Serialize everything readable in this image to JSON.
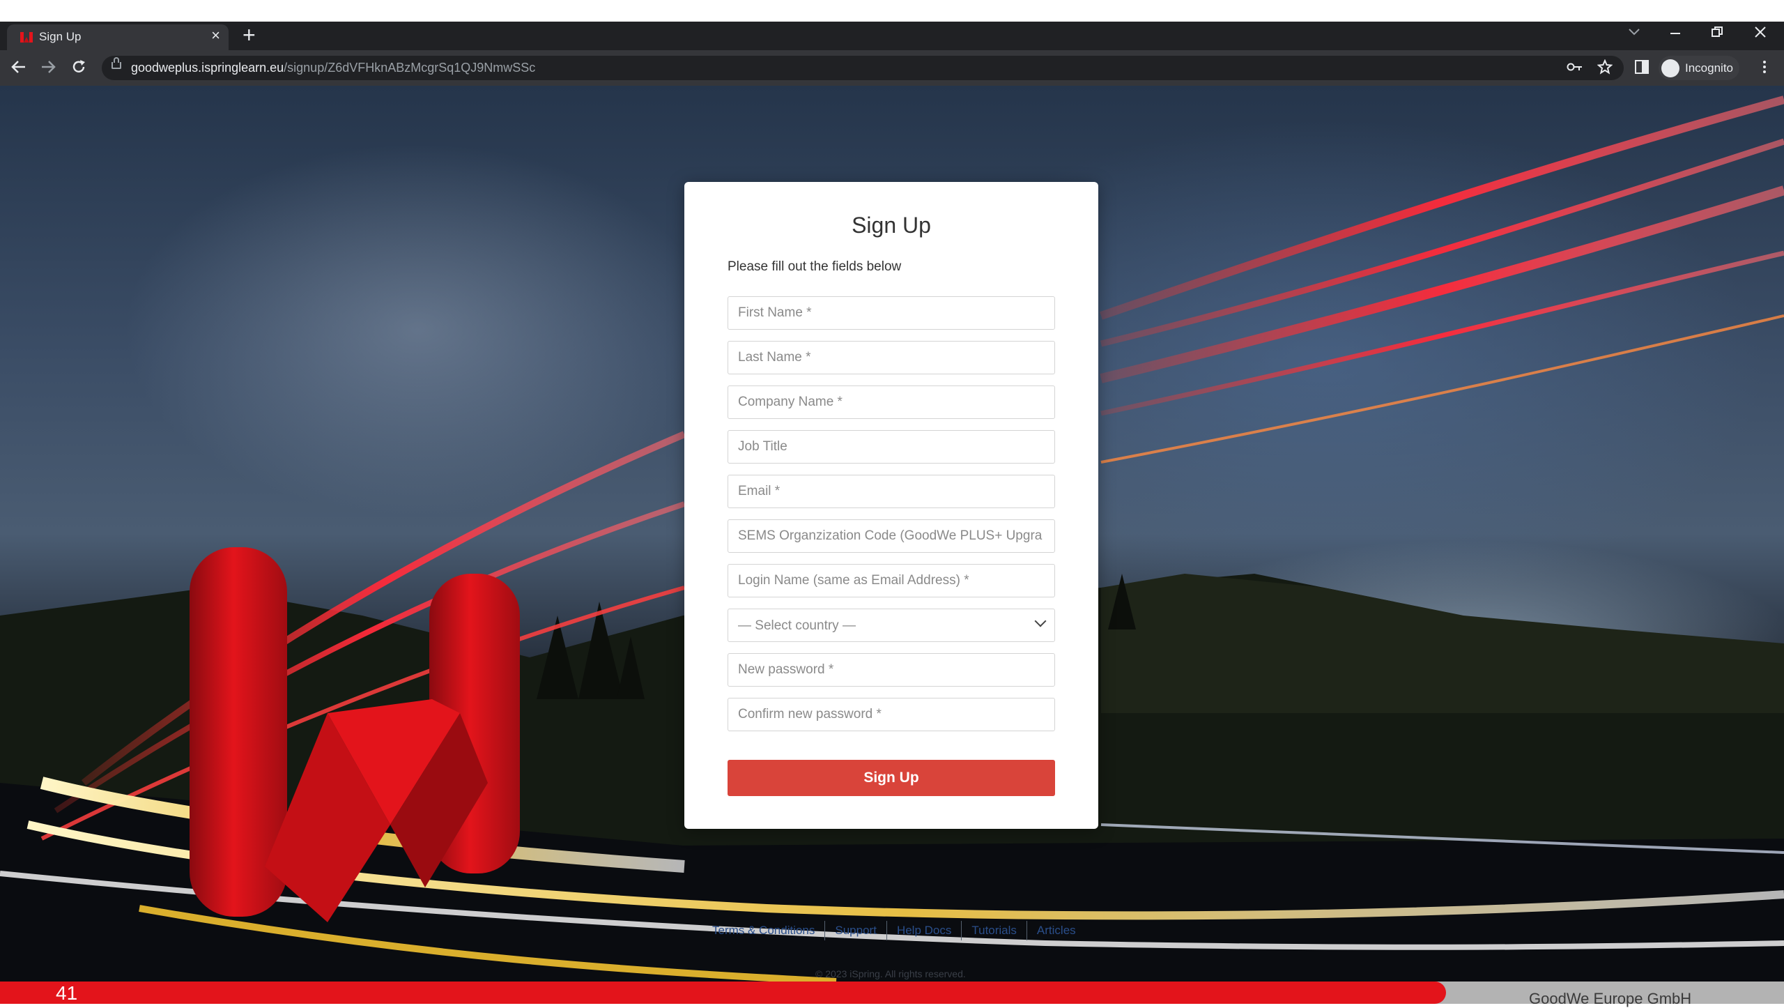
{
  "browser": {
    "tab_title": "Sign Up",
    "tab_close": "×",
    "new_tab": "+",
    "url_host": "goodweplus.ispringlearn.eu",
    "url_path": "/signup/Z6dVFHknABzMcgrSq1QJ9NmwSSc",
    "incognito_label": "Incognito",
    "icons": [
      "back-icon",
      "forward-icon",
      "reload-icon",
      "lock-icon",
      "key-icon",
      "star-icon",
      "side-panel-icon",
      "incognito-icon",
      "menu-icon",
      "tab-search-icon",
      "minimize-icon",
      "restore-icon",
      "close-icon"
    ]
  },
  "form": {
    "title": "Sign Up",
    "subtitle": "Please fill out the fields below",
    "fields": [
      {
        "name": "first-name",
        "placeholder": "First Name *"
      },
      {
        "name": "last-name",
        "placeholder": "Last Name *"
      },
      {
        "name": "company-name",
        "placeholder": "Company Name *"
      },
      {
        "name": "job-title",
        "placeholder": "Job Title"
      },
      {
        "name": "email",
        "placeholder": "Email *"
      },
      {
        "name": "sems-code",
        "placeholder": "SEMS Organzization Code (GoodWe PLUS+ Upgra"
      },
      {
        "name": "login-name",
        "placeholder": "Login Name (same as Email Address) *"
      }
    ],
    "country_select": "— Select country —",
    "password_fields": [
      {
        "name": "new-password",
        "placeholder": "New password *"
      },
      {
        "name": "confirm-password",
        "placeholder": "Confirm new password *"
      }
    ],
    "submit_label": "Sign Up"
  },
  "footer": {
    "links": [
      "Terms & Conditions",
      "Support",
      "Help Docs",
      "Tutorials",
      "Articles"
    ],
    "copyright": "© 2023 iSpring. All rights reserved."
  },
  "slide": {
    "page_number": "41",
    "company": "GoodWe Europe GmbH"
  },
  "colors": {
    "accent": "#d9443a",
    "slide_red": "#e3141b",
    "chrome_dark": "#202124"
  }
}
